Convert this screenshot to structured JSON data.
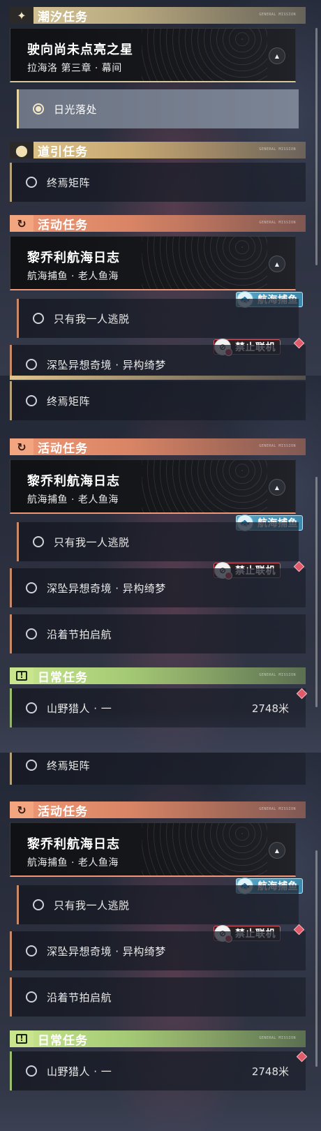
{
  "categories": {
    "tide": {
      "label": "潮汐任务",
      "icon": "four-point-star-icon"
    },
    "guide": {
      "label": "道引任务",
      "icon": "map-pin-icon"
    },
    "event": {
      "label": "活动任务",
      "icon": "event-swirl-icon"
    },
    "daily": {
      "label": "日常任务",
      "icon": "exclamation-box-icon"
    },
    "fine_print": "GENERAL MISSION"
  },
  "tide_quest": {
    "title": "驶向尚未点亮之星",
    "subtitle": "拉海洛 第三章 · 幕间",
    "step": "日光落处"
  },
  "guide_quest": {
    "step": "终焉矩阵"
  },
  "event_quest": {
    "title": "黎乔利航海日志",
    "subtitle": "航海捕鱼 · 老人鱼海",
    "steps": [
      "只有我一人逃脱",
      "深坠异想奇境 · 异构绮梦",
      "沿着节拍启航"
    ]
  },
  "badges": {
    "fishing": "航海捕鱼",
    "no_coop": "禁止联机"
  },
  "daily_quest": {
    "step": "山野猎人 · 一",
    "distance": "2748米"
  },
  "colors": {
    "tide_accent": "#d8c79a",
    "guide_accent": "#e0c58c",
    "event_accent": "#ef9775",
    "daily_accent": "#c9e68e",
    "alert_red": "#e05a6a"
  }
}
